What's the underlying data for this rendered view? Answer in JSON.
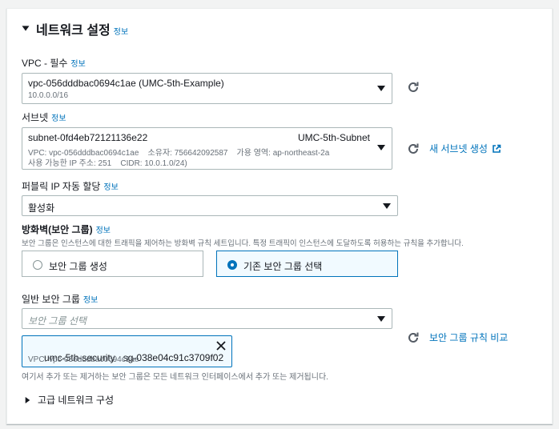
{
  "section": {
    "title": "네트워크 설정",
    "info": "정보"
  },
  "vpc": {
    "label": "VPC - 필수",
    "info": "정보",
    "value": "vpc-056dddbac0694c1ae (UMC-5th-Example)",
    "cidr": "10.0.0.0/16"
  },
  "subnet": {
    "label": "서브넷",
    "info": "정보",
    "id": "subnet-0fd4eb72121136e22",
    "name": "UMC-5th-Subnet",
    "detail1": "VPC: vpc-056dddbac0694c1ae    소유자: 756642092587    가용 영역: ap-northeast-2a",
    "detail2": "사용 가능한 IP 주소: 251    CIDR: 10.0.1.0/24)",
    "new_link": "새 서브넷 생성"
  },
  "public_ip": {
    "label": "퍼블릭 IP 자동 할당",
    "info": "정보",
    "value": "활성화"
  },
  "firewall": {
    "label": "방화벽(보안 그룹)",
    "info": "정보",
    "description": "보안 그룹은 인스턴스에 대한 트래픽을 제어하는 방화벽 규칙 세트입니다. 특정 트래픽이 인스턴스에 도달하도록 허용하는 규칙을 추가합니다.",
    "option_create": "보안 그룹 생성",
    "option_existing": "기존 보안 그룹 선택",
    "selected": "existing"
  },
  "common_sg": {
    "label": "일반 보안 그룹",
    "info": "정보",
    "placeholder": "보안 그룹 선택",
    "compare_link": "보안 그룹 규칙 비교",
    "token_name": "umc-5th-security",
    "token_id": "sg-038e04c91c3709f02",
    "token_vpc": "VPC: vpc-056dddbac0694c1ae",
    "hint": "여기서 추가 또는 제거하는 보안 그룹은 모든 네트워크 인터페이스에서 추가 또는 제거됩니다."
  },
  "advanced": {
    "label": "고급 네트워크 구성"
  },
  "colors": {
    "accent": "#0073bb",
    "border": "#aab7b8",
    "text": "#16191f",
    "muted": "#687078"
  },
  "icons": {
    "refresh": "refresh-icon",
    "external": "external-link-icon",
    "close": "close-icon"
  }
}
